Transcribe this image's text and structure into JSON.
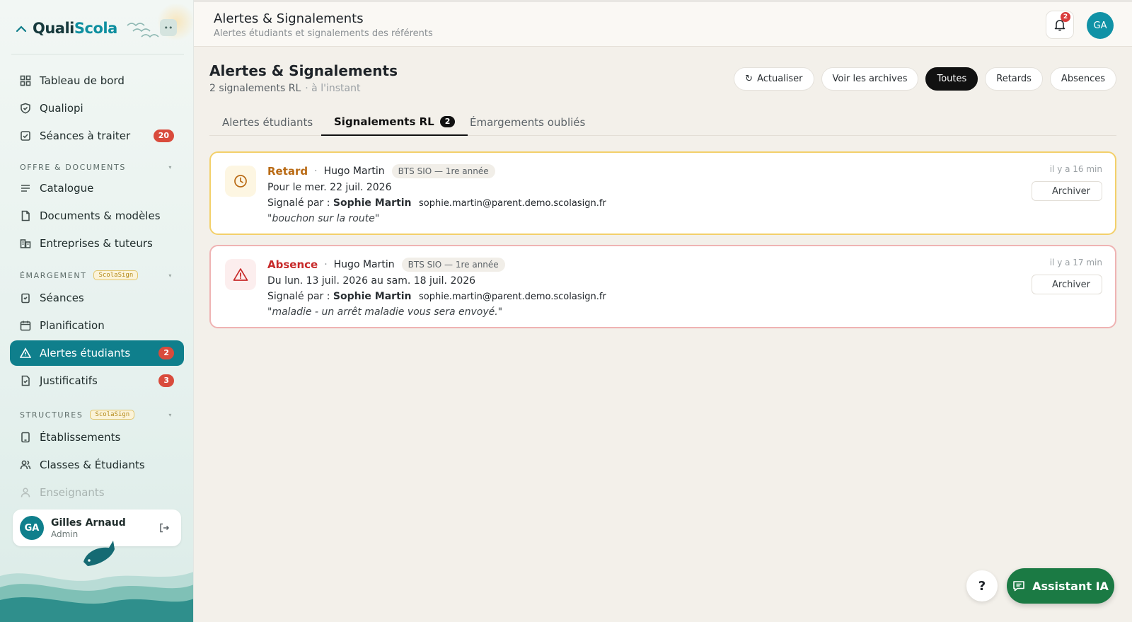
{
  "brand": {
    "name_part1": "Quali",
    "name_part2": "Scola"
  },
  "sidebar": {
    "items": [
      {
        "label": "Tableau de bord",
        "icon": "grid-icon"
      },
      {
        "label": "Qualiopi",
        "icon": "shield-icon"
      },
      {
        "label": "Séances à traiter",
        "icon": "checkbox-icon",
        "badge": "20"
      },
      {
        "label": "Catalogue",
        "icon": "list-icon"
      },
      {
        "label": "Documents & modèles",
        "icon": "document-icon"
      },
      {
        "label": "Entreprises & tuteurs",
        "icon": "building-icon"
      },
      {
        "label": "Séances",
        "icon": "clipboard-icon"
      },
      {
        "label": "Planification",
        "icon": "calendar-icon"
      },
      {
        "label": "Alertes étudiants",
        "icon": "warning-icon",
        "badge": "2"
      },
      {
        "label": "Justificatifs",
        "icon": "file-check-icon",
        "badge": "3"
      },
      {
        "label": "Établissements",
        "icon": "tablet-icon"
      },
      {
        "label": "Classes & Étudiants",
        "icon": "users-icon"
      },
      {
        "label": "Enseignants",
        "icon": "user-icon"
      }
    ],
    "sections": [
      {
        "label": "OFFRE & DOCUMENTS"
      },
      {
        "label": "ÉMARGEMENT",
        "tag": "ScolaSign"
      },
      {
        "label": "STRUCTURES",
        "tag": "ScolaSign"
      }
    ],
    "collapse_label": "••",
    "user": {
      "initials": "GA",
      "name": "Gilles Arnaud",
      "role": "Admin"
    }
  },
  "header": {
    "title": "Alertes & Signalements",
    "subtitle": "Alertes étudiants et signalements des référents",
    "notifications": "2",
    "avatar": "GA"
  },
  "main": {
    "title": "Alertes & Signalements",
    "count": "2 signalements RL",
    "updated": "· à l'instant",
    "actions": {
      "refresh": "Actualiser",
      "archives": "Voir les archives",
      "all": "Toutes",
      "late": "Retards",
      "absences": "Absences"
    },
    "tabs": [
      {
        "label": "Alertes étudiants"
      },
      {
        "label": "Signalements RL",
        "count": "2"
      },
      {
        "label": "Émargements oubliés"
      }
    ],
    "reports": [
      {
        "type": "Retard",
        "student": "Hugo Martin",
        "class": "BTS SIO — 1re année",
        "period": "Pour le mer. 22 juil. 2026",
        "reported_by_label": "Signalé par :",
        "reporter": "Sophie Martin",
        "email": "sophie.martin@parent.demo.scolasign.fr",
        "comment": "\"bouchon sur la route\"",
        "time": "il y a 16 min",
        "archive": "Archiver",
        "color": "#b96a14"
      },
      {
        "type": "Absence",
        "student": "Hugo Martin",
        "class": "BTS SIO — 1re année",
        "period": "Du lun. 13 juil. 2026 au sam. 18 juil. 2026",
        "reported_by_label": "Signalé par :",
        "reporter": "Sophie Martin",
        "email": "sophie.martin@parent.demo.scolasign.fr",
        "comment": "\"maladie - un arrêt maladie vous sera envoyé.\"",
        "time": "il y a 17 min",
        "archive": "Archiver",
        "color": "#c72a2a"
      }
    ]
  },
  "floating": {
    "help": "?",
    "assistant": "Assistant IA"
  }
}
